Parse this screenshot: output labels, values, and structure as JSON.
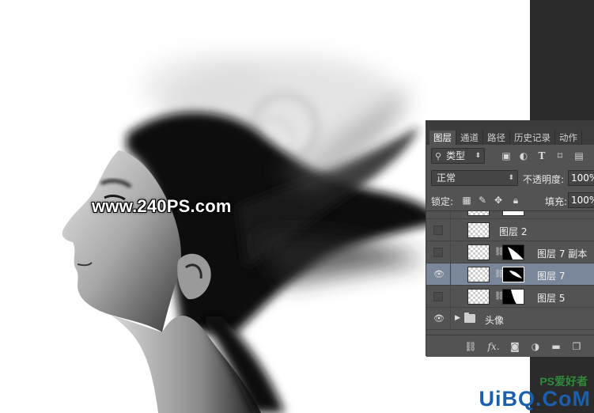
{
  "watermark": "www.240PS.com",
  "brand": "UiBQ.CoM",
  "brand_sub": "PS爱好者",
  "panel": {
    "tabs": [
      {
        "label": "图层",
        "active": true
      },
      {
        "label": "通道",
        "active": false
      },
      {
        "label": "路径",
        "active": false
      },
      {
        "label": "历史记录",
        "active": false
      },
      {
        "label": "动作",
        "active": false
      }
    ],
    "filter": {
      "kind_label": "类型",
      "icons": [
        "image-filter-icon",
        "adjustment-filter-icon",
        "type-filter-icon",
        "shape-filter-icon",
        "smart-object-filter-icon"
      ]
    },
    "blend_mode": "正常",
    "opacity_label": "不透明度:",
    "opacity_value": "100%",
    "lock_label": "锁定:",
    "fill_label": "填充:",
    "fill_value": "100%",
    "layers": [
      {
        "name": "图层 2",
        "visible": false,
        "has_mask": false,
        "selected": false
      },
      {
        "name": "图层 7 副本",
        "visible": false,
        "has_mask": true,
        "selected": false
      },
      {
        "name": "图层 7",
        "visible": true,
        "has_mask": true,
        "selected": true
      },
      {
        "name": "图层 5",
        "visible": false,
        "has_mask": true,
        "selected": false
      },
      {
        "name": "头像",
        "visible": true,
        "is_group": true,
        "selected": false
      }
    ],
    "bottom_icons": [
      "link-layers-icon",
      "fx-icon",
      "add-mask-icon",
      "adjustment-layer-icon",
      "new-group-icon",
      "new-layer-icon"
    ],
    "fx_label": "fx."
  },
  "colors": {
    "panel_bg": "#535353",
    "selected_row": "#7a8699",
    "brand_blue": "#1a5fb0"
  }
}
